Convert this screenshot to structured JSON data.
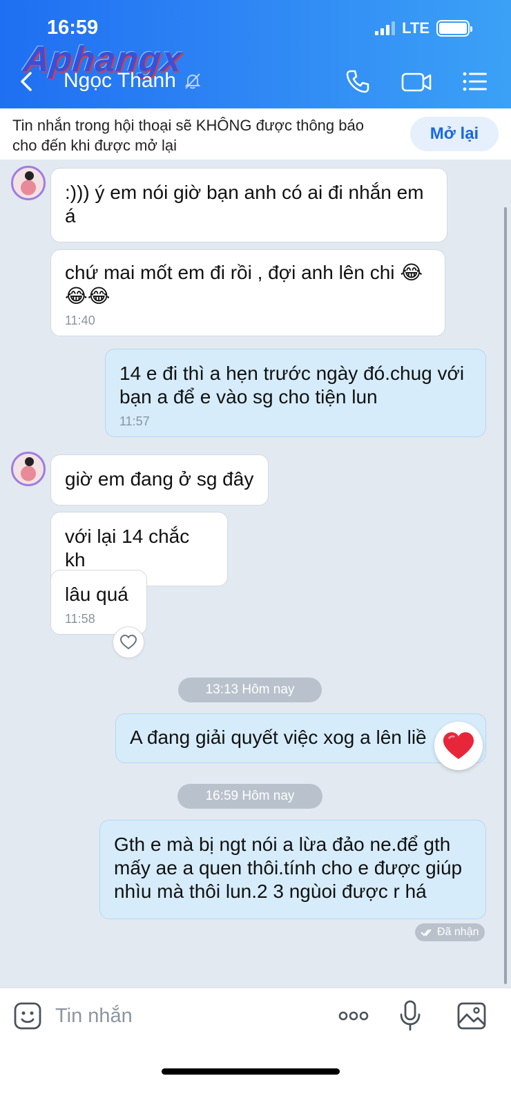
{
  "status_bar": {
    "time": "16:59",
    "network": "LTE"
  },
  "header": {
    "watermark": "Aphangx",
    "contact_name": "Ngọc Thanh",
    "icons": [
      "back-chevron-icon",
      "bell-off-icon",
      "phone-icon",
      "video-call-icon",
      "menu-list-icon"
    ]
  },
  "notice": {
    "text": "Tin nhắn trong hội thoại sẽ KHÔNG được thông báo cho đến khi được mở lại",
    "button": "Mở lại"
  },
  "messages": [
    {
      "dir": "in",
      "text": ":))) ý em nói giờ bạn anh có ai đi nhắn em á"
    },
    {
      "dir": "in",
      "text": "chứ mai mốt em đi rồi , đợi anh lên chi",
      "emoji": "😂\n😂😂",
      "time": "11:40"
    },
    {
      "dir": "out",
      "text": "14 e đi thì a hẹn trước ngày đó.chug với bạn a để e vào sg cho tiện lun",
      "time": "11:57"
    },
    {
      "dir": "in",
      "text": "giờ em đang ở sg đây"
    },
    {
      "dir": "in",
      "text": "với lại 14 chắc kh"
    },
    {
      "dir": "in",
      "text": "lâu quá",
      "time": "11:58",
      "reaction": "heart-outline-icon"
    },
    {
      "dir": "out",
      "text": "A đang giải quyết việc xog a lên liề",
      "reaction": "red-heart-icon"
    },
    {
      "dir": "out",
      "text": "Gth e mà bị ngt nói a lừa đảo ne.để gth mấy ae a quen thôi.tính cho e được giúp nhìu mà thôi lun.2 3 ngùoi được r há"
    }
  ],
  "separators": [
    "13:13 Hôm nay",
    "16:59 Hôm nay"
  ],
  "seen_status": "Đã nhận",
  "composer": {
    "placeholder": "Tin nhắn"
  },
  "colors": {
    "header_start": "#1f6ff2",
    "header_end": "#3ba1f6",
    "out_bubble": "#d6ecfb",
    "in_bubble": "#ffffff",
    "accent": "#1769e0",
    "background": "#e2e9f1"
  }
}
